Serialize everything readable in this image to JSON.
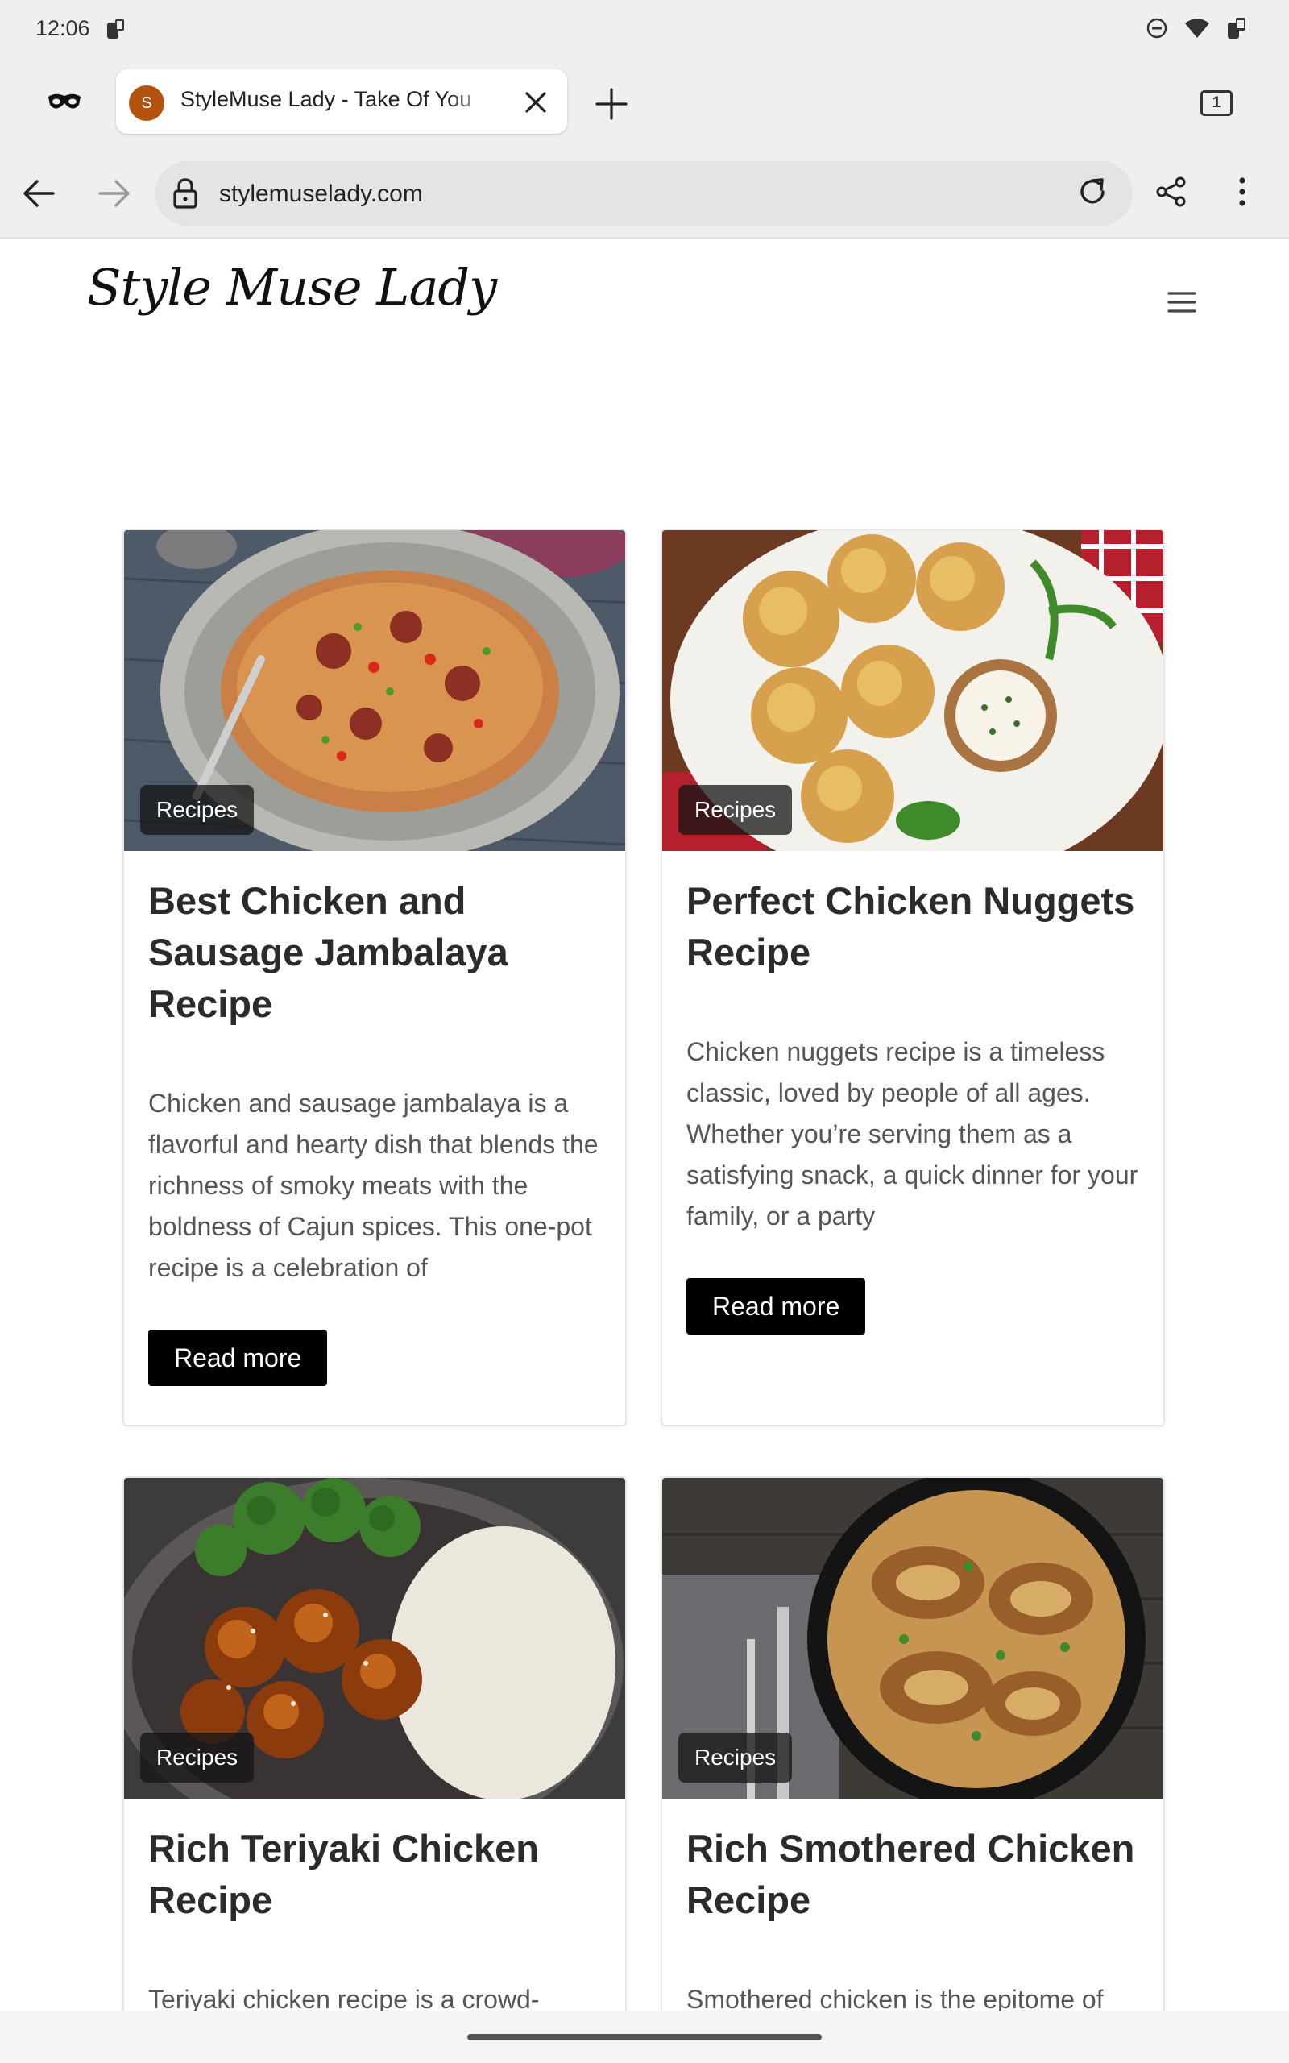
{
  "status_bar": {
    "time": "12:06",
    "icons": [
      "notification-icon",
      "do-not-disturb-icon",
      "wifi-icon",
      "battery-icon"
    ]
  },
  "browser": {
    "tab": {
      "favicon_letter": "S",
      "title": "StyleMuse Lady - Take Of You"
    },
    "tab_count": "1",
    "url": "stylemuselady.com"
  },
  "site": {
    "logo": "Style Muse Lady"
  },
  "posts": [
    {
      "category": "Recipes",
      "title": "Best Chicken and Sausage Jambalaya Recipe",
      "excerpt": "Chicken and sausage jambalaya is a flavorful and hearty dish that blends the richness of smoky meats with the boldness of Cajun spices. This one-pot recipe is a celebration of",
      "button": "Read more"
    },
    {
      "category": "Recipes",
      "title": "Perfect Chicken Nuggets Recipe",
      "excerpt": "Chicken nuggets recipe is a timeless classic, loved by people of all ages. Whether you’re serving them as a satisfying snack, a quick dinner for your family, or a party",
      "button": "Read more"
    },
    {
      "category": "Recipes",
      "title": "Rich Teriyaki Chicken Recipe",
      "excerpt": "Teriyaki chicken recipe is a crowd-"
    },
    {
      "category": "Recipes",
      "title": "Rich Smothered Chicken Recipe",
      "excerpt": "Smothered chicken is the epitome of"
    }
  ]
}
